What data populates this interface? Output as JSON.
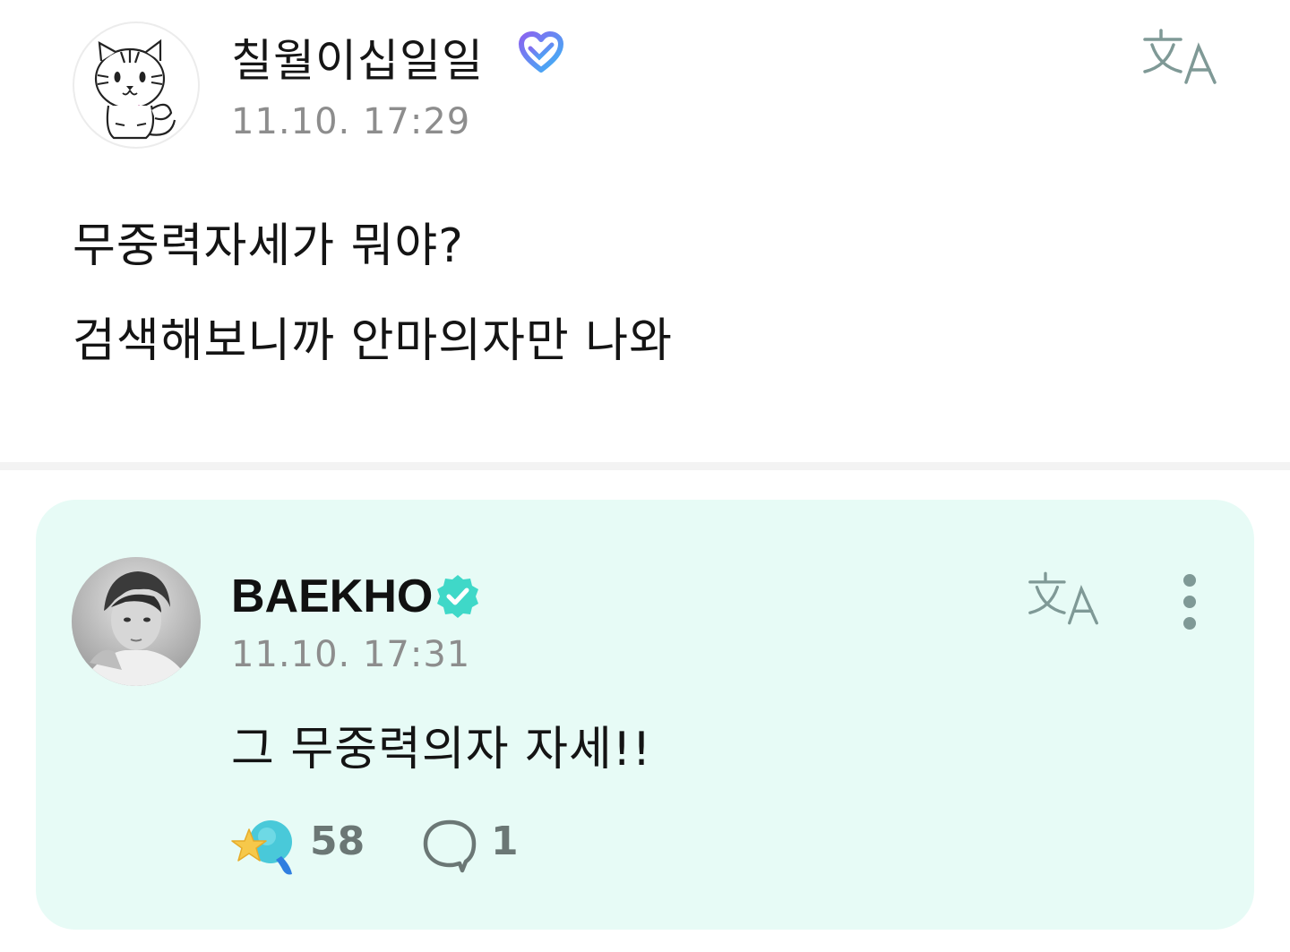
{
  "post": {
    "author": {
      "name": "칠월이십일일",
      "avatar": "tiger-cartoon-avatar",
      "badge": "membership-heart-icon"
    },
    "timestamp": "11.10. 17:29",
    "translate_icon": "translate-icon",
    "body_lines": [
      "무중력자세가 뭐야?",
      "검색해보니까 안마의자만 나와"
    ]
  },
  "comment": {
    "author": {
      "name": "BAEKHO",
      "avatar": "artist-photo-avatar",
      "badge": "verified-icon"
    },
    "timestamp": "11.10. 17:31",
    "translate_icon": "translate-icon",
    "more_icon": "more-vertical-icon",
    "text": "그 무중력의자 자세!!",
    "reactions": {
      "like_icon": "star-lightstick-icon",
      "like_count": "58",
      "reply_icon": "reply-bubble-icon",
      "reply_count": "1"
    }
  },
  "colors": {
    "card_background": "#e7fbf6",
    "verified": "#3fd8c8",
    "membership_gradient_start": "#8a63f0",
    "membership_gradient_end": "#3bb6f5",
    "timestamp": "#8d8d8d",
    "translate_icon": "#7f9996"
  }
}
